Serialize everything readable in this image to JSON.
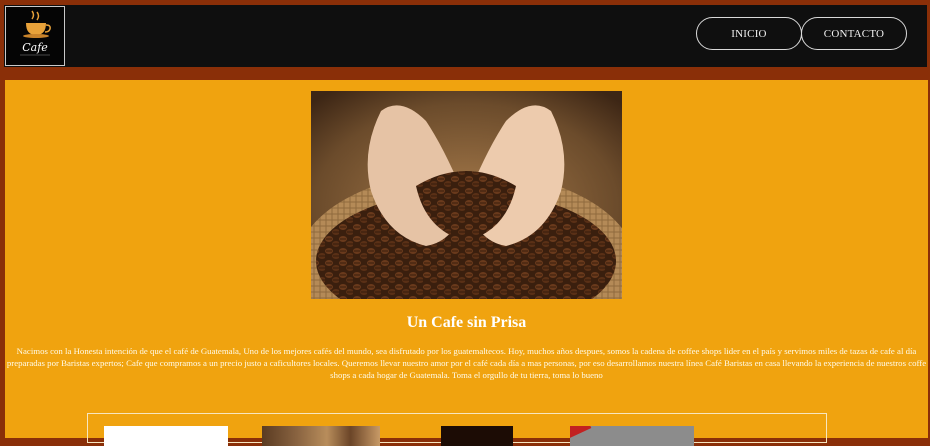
{
  "header": {
    "logo_text": "Cafe",
    "nav": [
      {
        "label": "INICIO"
      },
      {
        "label": "CONTACTO"
      }
    ]
  },
  "main": {
    "hero_alt": "coffee-beans-in-hands",
    "title": "Un Cafe sin Prisa",
    "description": "Nacimos con la Honesta intención de que el café de Guatemala, Uno de los mejores cafés del mundo, sea disfrutado por los guatemaltecos. Hoy, muchos años despues, somos la cadena de coffee shops lider en el país y servimos miles de tazas de cafe al día preparadas por Baristas expertos; Cafe que compramos a un precio justo a caficultores locales. Queremos llevar nuestro amor por el café cada día a mas personas, por eso desarrollamos nuestra línea Café Baristas en casa llevando la experiencia de nuestros coffe shops a cada hogar de Guatemala. Toma el orgullo de tu tierra, toma lo bueno"
  },
  "colors": {
    "page_bg": "#8a2f08",
    "header_bg": "#0f0f0f",
    "main_bg": "#f0a30f"
  }
}
